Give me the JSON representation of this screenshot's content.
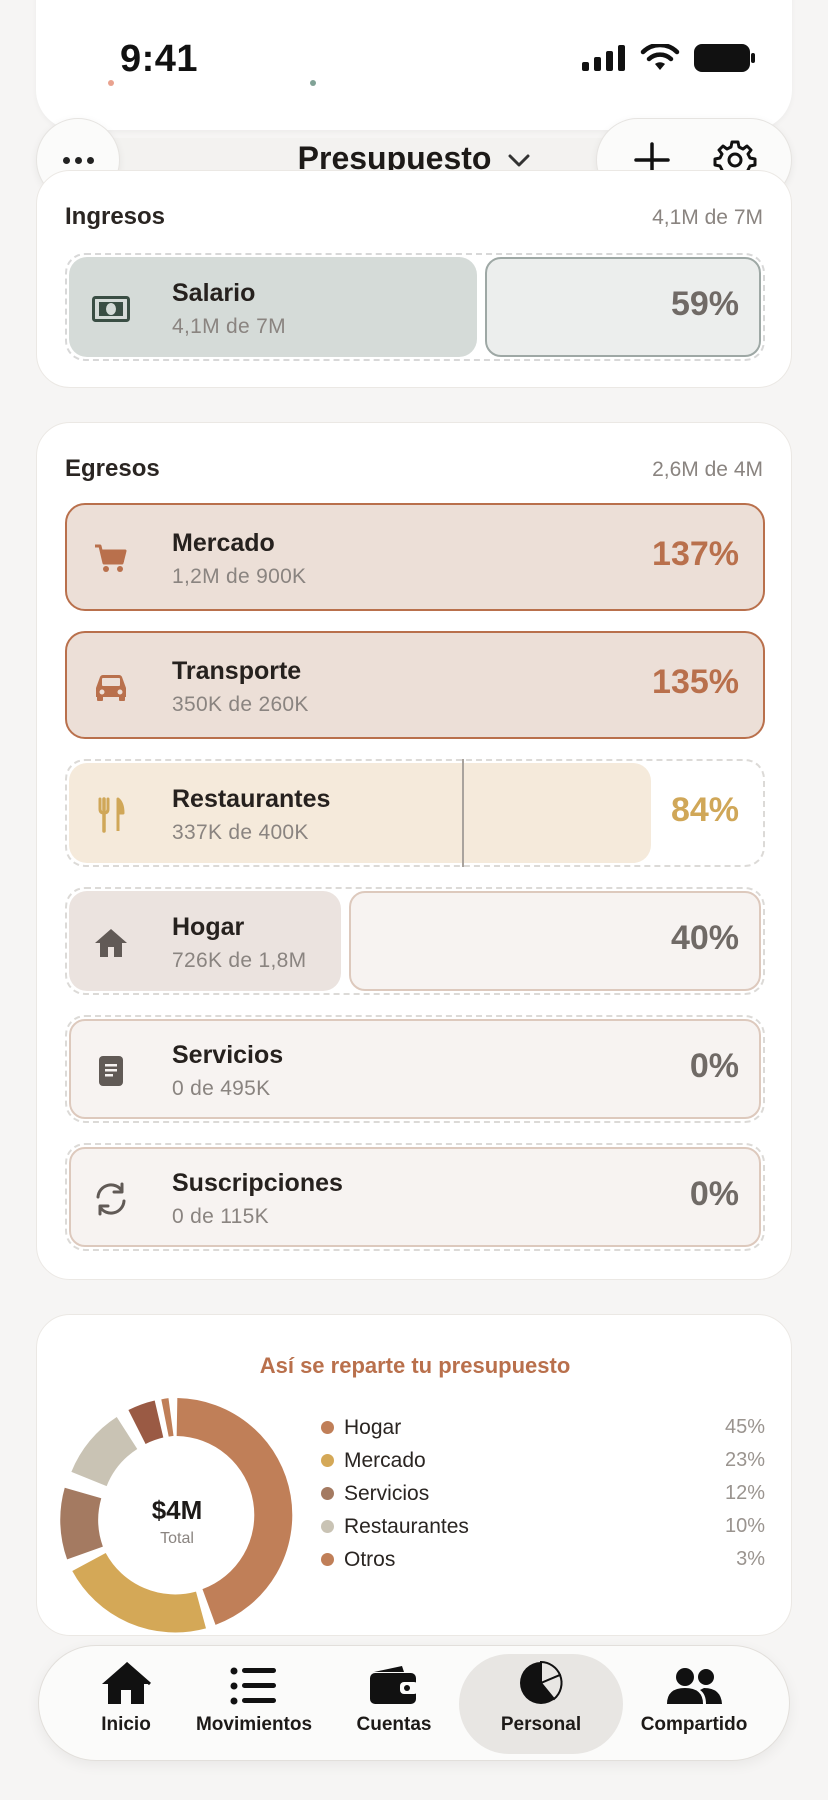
{
  "status_bar": {
    "time": "9:41"
  },
  "nav": {
    "title": "Presupuesto"
  },
  "ingresos": {
    "title": "Ingresos",
    "summary": "4,1M de 7M",
    "items": [
      {
        "name": "Salario",
        "sub": "4,1M de 7M",
        "pct": "59%",
        "progress": 0.59
      }
    ]
  },
  "egresos": {
    "title": "Egresos",
    "summary": "2,6M de 4M",
    "items": [
      {
        "name": "Mercado",
        "sub": "1,2M de 900K",
        "pct": "137%",
        "progress": 1.37
      },
      {
        "name": "Transporte",
        "sub": "350K de 260K",
        "pct": "135%",
        "progress": 1.35
      },
      {
        "name": "Restaurantes",
        "sub": "337K de 400K",
        "pct": "84%",
        "progress": 0.84
      },
      {
        "name": "Hogar",
        "sub": "726K de 1,8M",
        "pct": "40%",
        "progress": 0.4
      },
      {
        "name": "Servicios",
        "sub": "0 de 495K",
        "pct": "0%",
        "progress": 0
      },
      {
        "name": "Suscripciones",
        "sub": "0 de 115K",
        "pct": "0%",
        "progress": 0
      }
    ]
  },
  "distribution": {
    "title": "Así se reparte tu presupuesto",
    "center_value": "$4M",
    "center_label": "Total",
    "legend": [
      {
        "name": "Hogar",
        "value": "45%",
        "color": "#c07f58"
      },
      {
        "name": "Mercado",
        "value": "23%",
        "color": "#d4a857"
      },
      {
        "name": "Servicios",
        "value": "12%",
        "color": "#a47a61"
      },
      {
        "name": "Restaurantes",
        "value": "10%",
        "color": "#c9c3b4"
      },
      {
        "name": "Otros",
        "value": "3%",
        "color": "#c07f58"
      }
    ]
  },
  "tabs": [
    {
      "label": "Inicio",
      "icon": "home-icon"
    },
    {
      "label": "Movimientos",
      "icon": "list-icon"
    },
    {
      "label": "Cuentas",
      "icon": "wallet-icon"
    },
    {
      "label": "Personal",
      "icon": "pie-chart-icon",
      "active": true
    },
    {
      "label": "Compartido",
      "icon": "people-icon"
    }
  ],
  "colors": {
    "over": "#b9704c",
    "over_bg": "#ecdfd7",
    "warn": "#d0a758",
    "warn_bg": "#f5eadb",
    "income_bg": "#d5dbd8",
    "neutral_pct": "#706a66"
  }
}
